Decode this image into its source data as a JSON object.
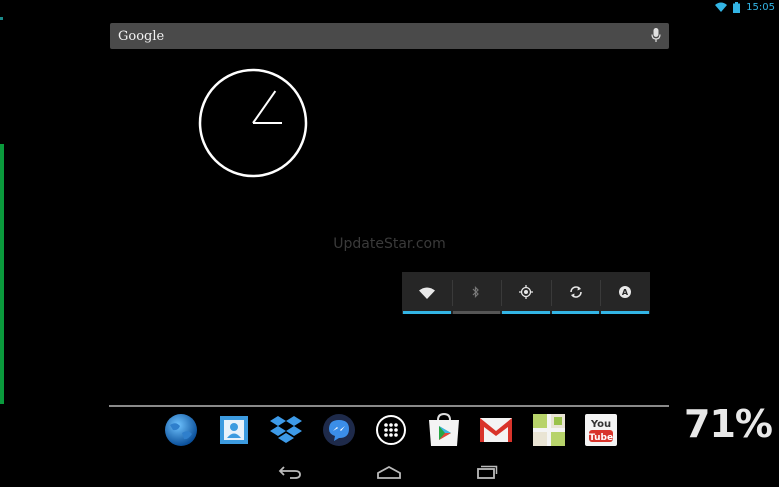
{
  "status_bar": {
    "time": "15:05",
    "icons": [
      "wifi-icon",
      "battery-icon"
    ],
    "accent_color": "#33b5e5"
  },
  "search": {
    "logo_text": "Google",
    "icon": "mic-icon"
  },
  "clock": {
    "type": "analog",
    "hour_hand_angle_deg": 35,
    "minute_hand_angle_deg": 90
  },
  "watermark": "UpdateStar.com",
  "power_widget": {
    "toggles": [
      {
        "name": "wifi",
        "icon": "wifi-icon",
        "on": true
      },
      {
        "name": "bluetooth",
        "icon": "bluetooth-icon",
        "on": false
      },
      {
        "name": "gps",
        "icon": "gps-icon",
        "on": true
      },
      {
        "name": "sync",
        "icon": "sync-icon",
        "on": true
      },
      {
        "name": "brightness",
        "icon": "brightness-auto-icon",
        "on": true
      }
    ]
  },
  "dock": {
    "apps": [
      "browser",
      "contacts",
      "dropbox",
      "messenger",
      "all-apps",
      "play-store",
      "gmail",
      "maps",
      "youtube"
    ],
    "youtube_label_top": "You",
    "youtube_label_bottom": "Tube"
  },
  "battery_percent": "71%",
  "nav": [
    "back-icon",
    "home-icon",
    "recent-apps-icon"
  ]
}
